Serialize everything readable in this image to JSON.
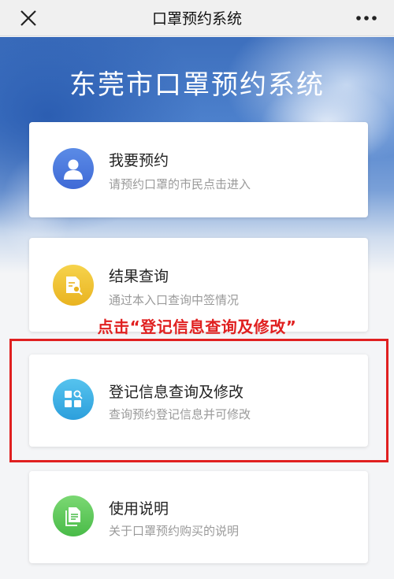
{
  "topbar": {
    "title": "口罩预约系统",
    "close_icon": "close-icon",
    "more_icon": "more-icon"
  },
  "hero": {
    "title": "东莞市口罩预约系统"
  },
  "cards": [
    {
      "title": "我要预约",
      "subtitle": "请预约口罩的市民点击进入",
      "icon": "person-icon",
      "color": "#4a78dc"
    },
    {
      "title": "结果查询",
      "subtitle": "通过本入口查询中签情况",
      "icon": "document-search-icon",
      "color": "#efc132"
    },
    {
      "title": "登记信息查询及修改",
      "subtitle": "查询预约登记信息并可修改",
      "icon": "grid-search-icon",
      "color": "#3aaee4"
    },
    {
      "title": "使用说明",
      "subtitle": "关于口罩预约购买的说明",
      "icon": "document-icon",
      "color": "#5ec95a"
    }
  ],
  "annotation": {
    "text": "点击“登记信息查询及修改”",
    "color": "#e02020"
  }
}
